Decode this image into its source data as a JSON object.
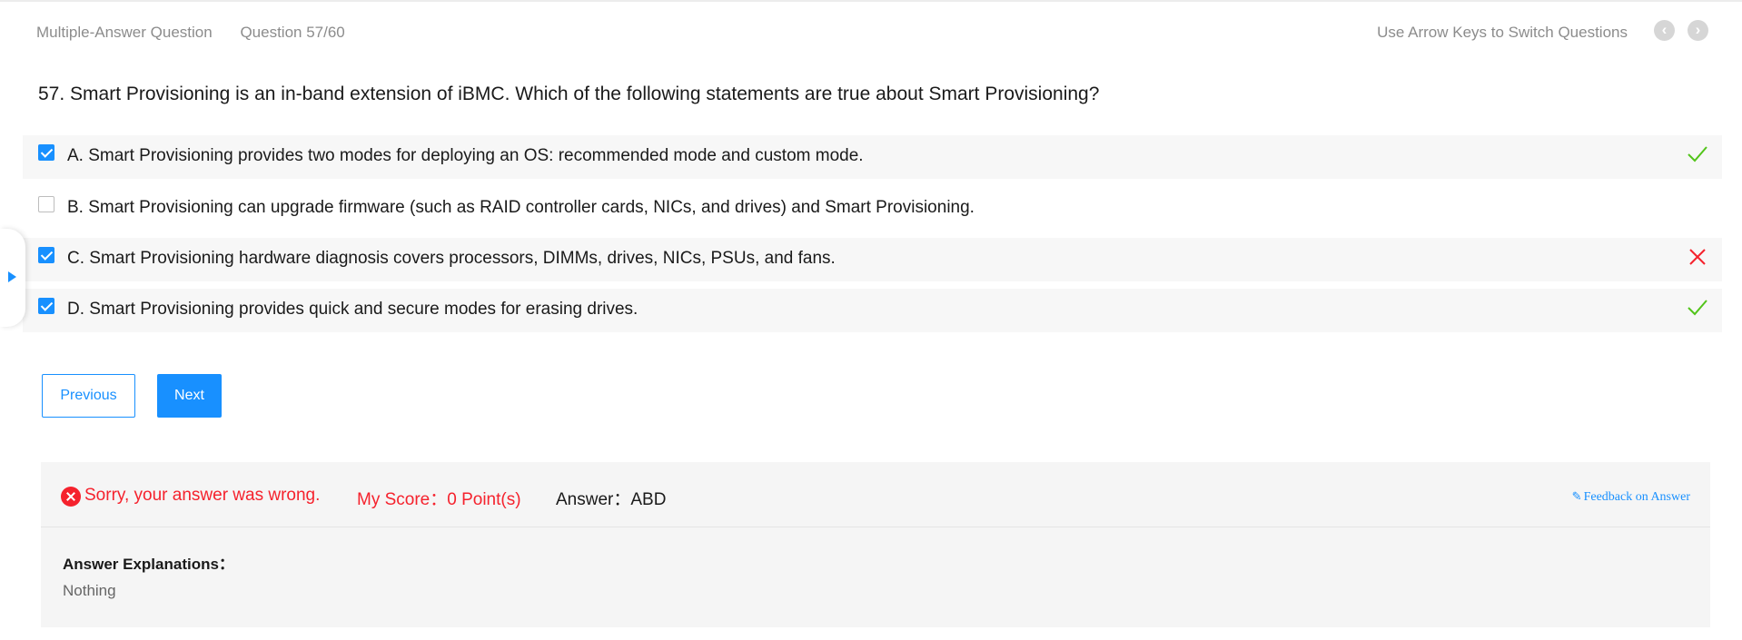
{
  "header": {
    "question_type": "Multiple-Answer Question",
    "question_counter": "Question 57/60",
    "hint": "Use Arrow Keys to Switch Questions",
    "prev_icon": "chevron-left-icon",
    "next_icon": "chevron-right-icon"
  },
  "question": {
    "text": "57. Smart Provisioning is an in-band extension of iBMC. Which of the following statements are true about Smart Provisioning?"
  },
  "options": [
    {
      "text": "A. Smart Provisioning provides two modes for deploying an OS: recommended mode and custom mode.",
      "checked": true,
      "mark": "correct"
    },
    {
      "text": "B. Smart Provisioning can upgrade firmware (such as RAID controller cards, NICs, and drives) and Smart Provisioning.",
      "checked": false,
      "mark": "none"
    },
    {
      "text": "C. Smart Provisioning hardware diagnosis covers processors, DIMMs, drives, NICs, PSUs, and fans.",
      "checked": true,
      "mark": "wrong"
    },
    {
      "text": "D. Smart Provisioning provides quick and secure modes for erasing drives.",
      "checked": true,
      "mark": "correct"
    }
  ],
  "buttons": {
    "previous": "Previous",
    "next": "Next"
  },
  "result": {
    "status": "Sorry, your answer was wrong.",
    "score": "My Score：0 Point(s)",
    "answer": "Answer：ABD",
    "feedback": "Feedback on Answer"
  },
  "explanation": {
    "title": "Answer Explanations：",
    "body": "Nothing"
  },
  "colors": {
    "accent": "#1890ff",
    "error": "#f5222d",
    "success": "#52c41a"
  }
}
